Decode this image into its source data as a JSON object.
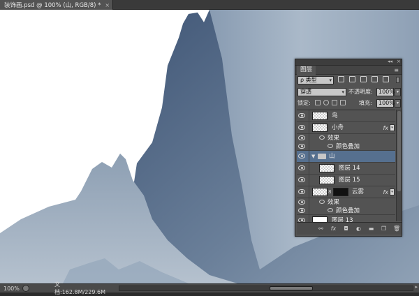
{
  "document": {
    "tab_title": "装饰画.psd @ 100% (山, RGB/8) *",
    "close_glyph": "×"
  },
  "status_bar": {
    "zoom": "100%",
    "doc_info": "文档:162.8M/229.6M",
    "play_glyph": "▶",
    "left_arrow": "◂",
    "right_arrow": "▸"
  },
  "layers_panel": {
    "tab_label": "图层",
    "collapse_glyph": "◂◂",
    "close_glyph": "×",
    "menu_glyph": "≡",
    "filter": {
      "kind_label": "ρ 类型",
      "arrow": "▾"
    },
    "blend": {
      "mode": "穿透",
      "opacity_label": "不透明度:",
      "opacity_value": "100%",
      "fill_label": "填充:",
      "fill_value": "100%",
      "arrow": "▾"
    },
    "lock_label": "锁定:",
    "layers": [
      {
        "name": "鸟",
        "type": "layer",
        "thumb": "transparent",
        "fx": false
      },
      {
        "name": "小舟",
        "type": "layer",
        "thumb": "transparent",
        "fx": true,
        "fx_label": "fx",
        "toggle": "▾"
      },
      {
        "name": "效果",
        "type": "effects-header"
      },
      {
        "name": "颜色叠加",
        "type": "effect"
      },
      {
        "name": "山",
        "type": "group",
        "expanded_glyph": "▼",
        "selected": true
      },
      {
        "name": "图层 14",
        "type": "layer",
        "thumb": "transparent",
        "indented": true
      },
      {
        "name": "图层 15",
        "type": "layer",
        "thumb": "transparent",
        "indented": true
      },
      {
        "name": "云雾",
        "type": "layer",
        "thumb": "transparent",
        "mask": true,
        "fx": true,
        "fx_label": "fx",
        "toggle": "▾",
        "chain_glyph": "8"
      },
      {
        "name": "效果",
        "type": "effects-header"
      },
      {
        "name": "颜色叠加",
        "type": "effect"
      },
      {
        "name": "图层 13",
        "type": "layer",
        "thumb": "white",
        "fx": false
      }
    ],
    "bottom_icons": [
      "link-icon",
      "fx-icon",
      "mask-icon",
      "adjustment-icon",
      "group-icon",
      "new-layer-icon",
      "trash-icon"
    ],
    "bottom_glyphs": [
      "⚯",
      "fx",
      "◘",
      "◐",
      "▬",
      "❐",
      "🗑"
    ]
  },
  "colors": {
    "panel_bg": "#535353",
    "selected": "#56708f",
    "sky": "#9aabbd",
    "mountain": "#4f6582"
  }
}
